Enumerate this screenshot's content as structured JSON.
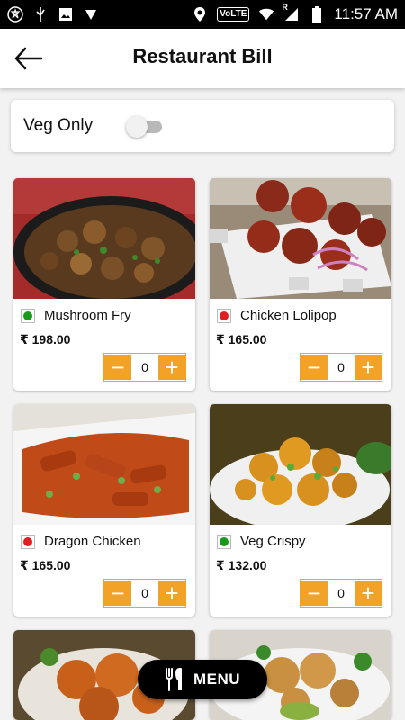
{
  "status_bar": {
    "time": "11:57 AM",
    "network": "VoLTE",
    "roaming": "R",
    "icons": [
      "app-icon",
      "usb-icon",
      "image-icon",
      "signal-app-icon",
      "location-icon",
      "wifi-icon",
      "cell-signal-icon",
      "battery-icon"
    ]
  },
  "header": {
    "title": "Restaurant Bill",
    "back_icon": "arrow-left-icon"
  },
  "filter": {
    "veg_only_label": "Veg Only",
    "veg_only_enabled": false
  },
  "products": [
    {
      "name": "Mushroom Fry",
      "price": "₹ 198.00",
      "quantity": "0",
      "type": "veg",
      "type_color": "#1a9a1a",
      "image": "mushroom-fry-image"
    },
    {
      "name": "Chicken Lolipop",
      "price": "₹ 165.00",
      "quantity": "0",
      "type": "non-veg",
      "type_color": "#e02020",
      "image": "chicken-lolipop-image"
    },
    {
      "name": "Dragon Chicken",
      "price": "₹ 165.00",
      "quantity": "0",
      "type": "non-veg",
      "type_color": "#e02020",
      "image": "dragon-chicken-image"
    },
    {
      "name": "Veg Crispy",
      "price": "₹ 132.00",
      "quantity": "0",
      "type": "veg",
      "type_color": "#1a9a1a",
      "image": "veg-crispy-image"
    }
  ],
  "stepper_symbols": {
    "minus": "−",
    "plus": "+"
  },
  "menu_button": {
    "label": "MENU",
    "icon": "cutlery-icon"
  },
  "colors": {
    "accent": "#f2a327",
    "veg": "#1a9a1a",
    "non_veg": "#e02020"
  }
}
